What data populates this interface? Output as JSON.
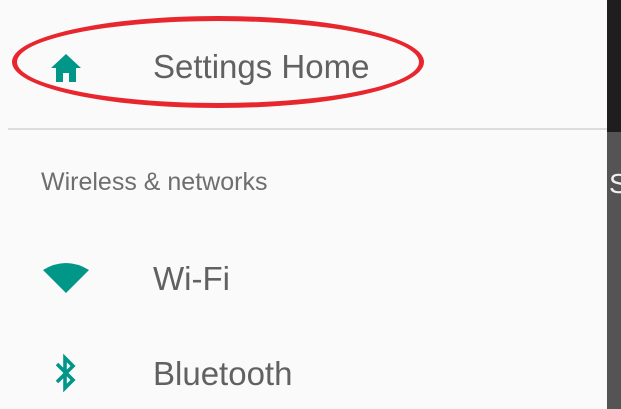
{
  "colors": {
    "accent": "#009688",
    "highlight": "#e8262e",
    "label": "#616161",
    "section": "#6e6e6e"
  },
  "drawer": {
    "home": {
      "label": "Settings Home",
      "icon": "home-icon"
    },
    "section_header": "Wireless & networks",
    "items": [
      {
        "label": "Wi-Fi",
        "icon": "wifi-icon"
      },
      {
        "label": "Bluetooth",
        "icon": "bluetooth-icon"
      }
    ]
  },
  "background": {
    "visible_char": "S"
  }
}
